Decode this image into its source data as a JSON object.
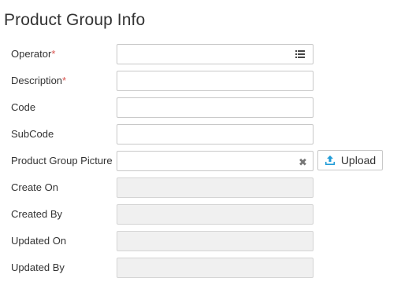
{
  "page": {
    "title": "Product Group Info"
  },
  "colors": {
    "required_marker": "#d9534f",
    "upload_icon": "#1e9bd7",
    "readonly_field_bg": "#f0f0f0"
  },
  "form": {
    "operator": {
      "label": "Operator",
      "required_mark": "*",
      "value": "",
      "icon": "list-icon"
    },
    "description": {
      "label": "Description",
      "required_mark": "*",
      "value": ""
    },
    "code": {
      "label": "Code",
      "value": ""
    },
    "subcode": {
      "label": "SubCode",
      "value": ""
    },
    "picture": {
      "label": "Product Group Picture",
      "value": "",
      "clear_glyph": "✖",
      "upload_label": "Upload",
      "upload_icon": "upload-icon"
    },
    "create_on": {
      "label": "Create On",
      "value": ""
    },
    "created_by": {
      "label": "Created By",
      "value": ""
    },
    "updated_on": {
      "label": "Updated On",
      "value": ""
    },
    "updated_by": {
      "label": "Updated By",
      "value": ""
    }
  }
}
